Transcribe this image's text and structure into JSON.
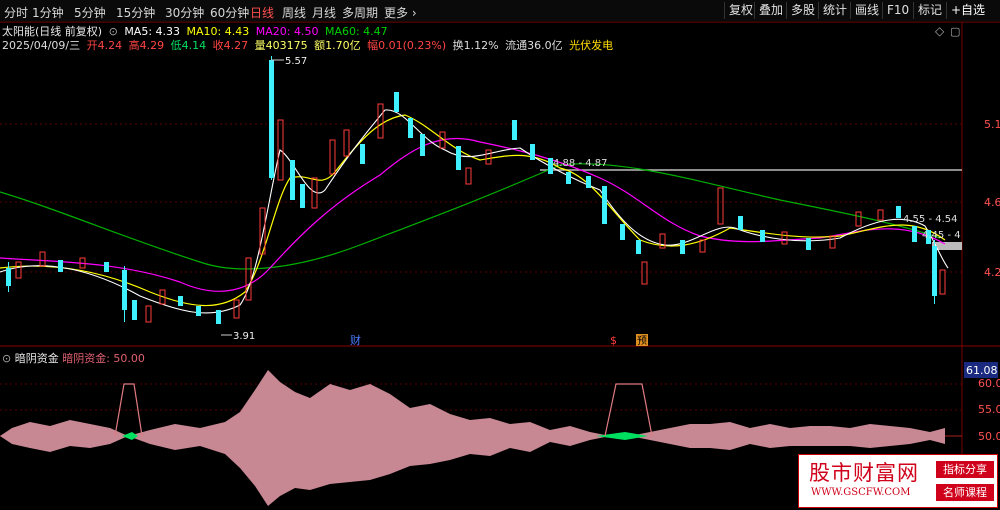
{
  "periods": [
    "分时",
    "1分钟",
    "5分钟",
    "15分钟",
    "30分钟",
    "60分钟",
    "日线",
    "周线",
    "月线",
    "多周期",
    "更多"
  ],
  "active_period": "日线",
  "right_buttons": [
    "复权",
    "叠加",
    "多股",
    "统计",
    "画线",
    "F10",
    "标记",
    "+自选"
  ],
  "stock": {
    "name": "太阳能(日线 前复权)",
    "concept": "光伏发电"
  },
  "ma": {
    "ma5": "MA5: 4.33",
    "ma10": "MA10: 4.43",
    "ma20": "MA20: 4.50",
    "ma60": "MA60: 4.47"
  },
  "quote": {
    "date": "2025/04/09/三",
    "open": "开4.24",
    "high": "高4.29",
    "low": "低4.14",
    "close": "收4.27",
    "volume": "量403175",
    "amount": "额1.70亿",
    "change": "幅0.01(0.23%)",
    "turnover": "换1.12%",
    "float_cap": "流通36.0亿"
  },
  "price_axis": [
    "5.1",
    "4.6",
    "4.2"
  ],
  "annotations": {
    "high": "5.57",
    "low": "3.91",
    "range1": "4.88 - 4.87",
    "range2": "4.55 - 4.54",
    "range3": "4.45 - 4"
  },
  "markers": {
    "cai": "财",
    "s": "$",
    "yu": "预"
  },
  "indicator": {
    "name": "暗阴资金",
    "value_label": "暗阴资金: 50.00",
    "current": "61.08",
    "axis": [
      "60.0",
      "55.0",
      "50.0"
    ]
  },
  "watermark": {
    "title": "股市财富网",
    "url": "WWW.GSCFW.COM",
    "badge1": "指标分享",
    "badge2": "名师课程"
  },
  "colors": {
    "up": "#ff3b3b",
    "down": "#3ff0ff",
    "ma5": "#ffffff",
    "ma10": "#ffff00",
    "ma20": "#ff00ff",
    "ma60": "#00c000",
    "indicator": "#c78793"
  }
}
